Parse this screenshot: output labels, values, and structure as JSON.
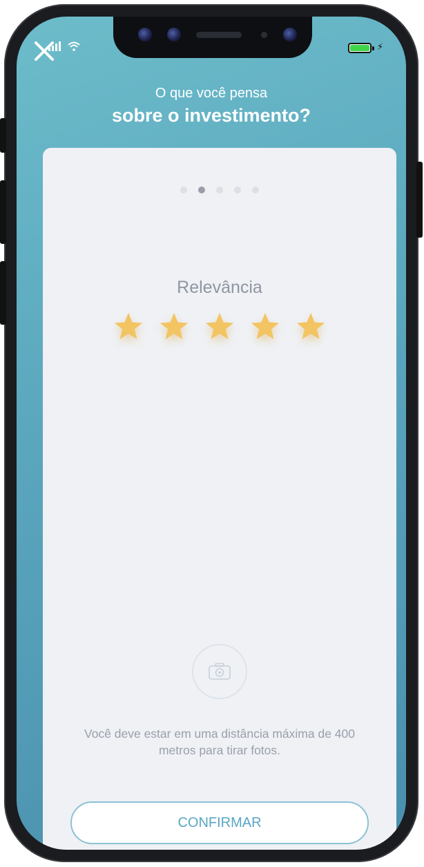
{
  "header": {
    "subtitle": "O que você pensa",
    "title": "sobre o investimento?"
  },
  "pager": {
    "total": 5,
    "active_index": 1
  },
  "rating": {
    "label": "Relevância",
    "value": 5,
    "max": 5,
    "star_color": "#f2c462"
  },
  "photo": {
    "icon": "camera-icon",
    "note": "Você deve estar em uma distância máxima de 400 metros para tirar fotos."
  },
  "actions": {
    "confirm_label": "CONFIRMAR"
  },
  "colors": {
    "header_gradient_start": "#6cbcca",
    "header_gradient_end": "#4a8fae",
    "accent": "#5aa6c2",
    "card_background": "#eff1f5"
  },
  "icons": [
    "close-icon",
    "signal-icon",
    "wifi-icon",
    "battery-icon",
    "star-icon",
    "camera-icon"
  ]
}
